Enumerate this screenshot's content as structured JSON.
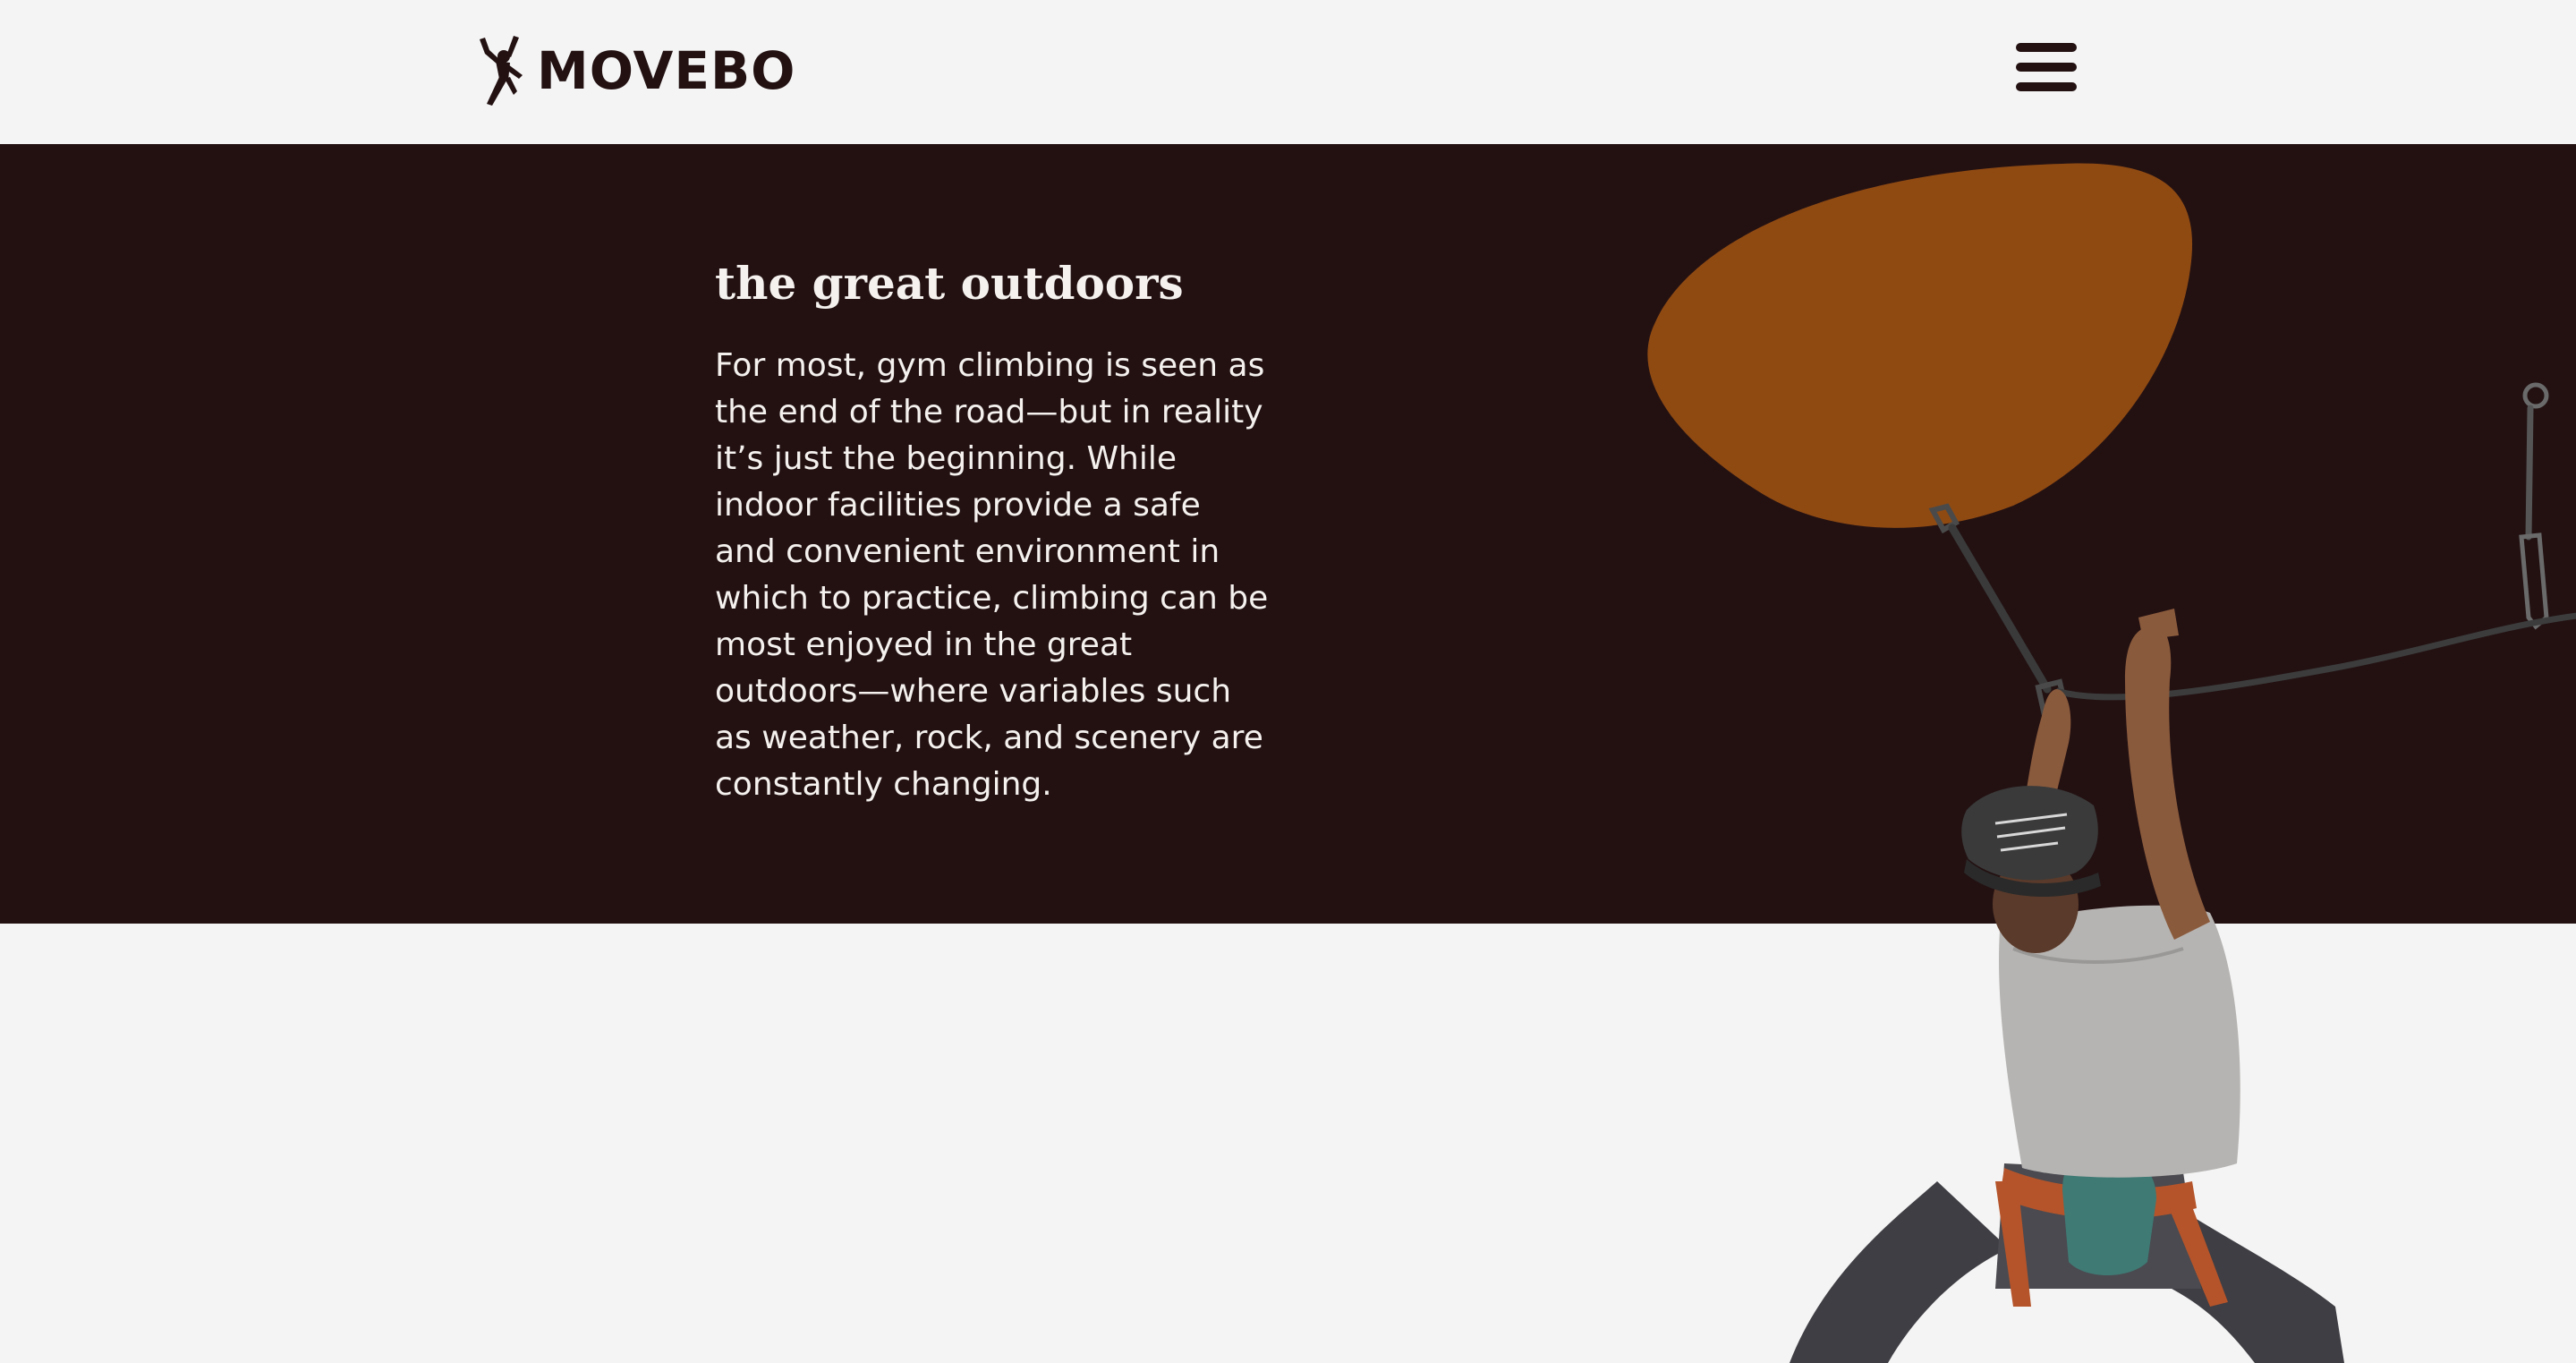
{
  "header": {
    "brand_name": "MOVEBO",
    "logo_icon": "climber-logo-icon",
    "menu_icon": "hamburger-menu-icon"
  },
  "hero": {
    "title": "the great outdoors",
    "body": "For most, gym climbing is seen as the end of the road—but in reality it’s just the beginning. While indoor facilities provide a safe and convenient environment in which to practice, climbing can be most enjoyed in the great outdoors—where variables such as weather, rock, and scenery are constantly changing."
  },
  "colors": {
    "page_background": "#f4f4f4",
    "hero_background": "#231112",
    "accent_blob": "#8f4a12",
    "text_light": "#f4f1ee",
    "brand_dark": "#231112"
  }
}
